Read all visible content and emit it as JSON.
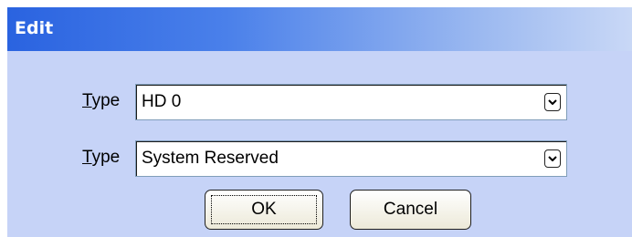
{
  "dialog": {
    "title": "Edit",
    "fields": [
      {
        "label_mnemonic": "T",
        "label_rest": "ype",
        "value": "HD 0"
      },
      {
        "label_mnemonic": "T",
        "label_rest": "ype",
        "value": "System Reserved"
      }
    ],
    "buttons": {
      "ok_label": "OK",
      "cancel_label": "Cancel"
    }
  },
  "colors": {
    "dialog_background": "#c6d3f7",
    "titlebar_start": "#2a63e0",
    "titlebar_end": "#c9d8f6"
  },
  "icons": {
    "dropdown": "chevron-down-icon"
  }
}
